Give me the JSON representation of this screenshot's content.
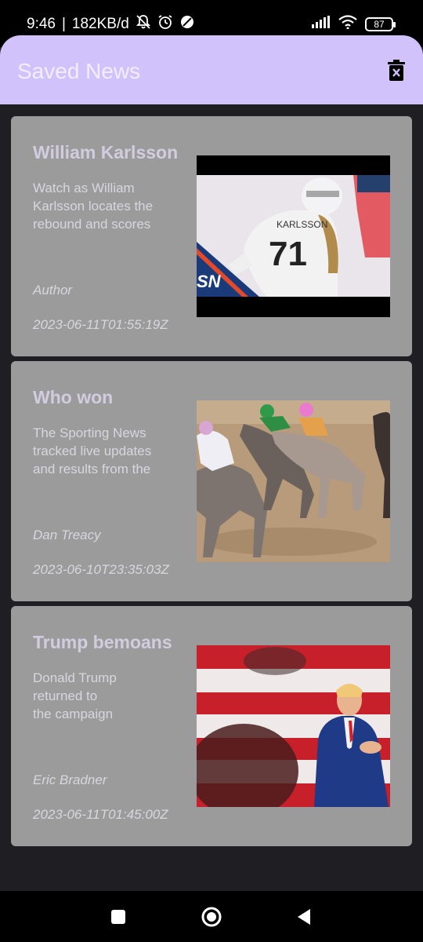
{
  "status_bar": {
    "time": "9:46",
    "network_speed": "182KB/d",
    "battery_level": "87",
    "icons": [
      "bell-off-icon",
      "alarm-icon",
      "data-saver-icon",
      "signal-icon",
      "wifi-icon",
      "battery-icon"
    ]
  },
  "app_bar": {
    "title": "Saved News",
    "action_icon": "delete-icon"
  },
  "articles": [
    {
      "title": "William Karlsson",
      "description": "Watch as William\nKarlsson locates the\nrebound and scores",
      "author": "Author",
      "published_at": "2023-06-11T01:55:19Z",
      "image_alt": "hockey player number 71 in white jersey"
    },
    {
      "title": "Who won",
      "description": "The Sporting News\ntracked live updates\nand results from the",
      "author": "Dan Treacy",
      "published_at": "2023-06-10T23:35:03Z",
      "image_alt": "horse race on dirt track"
    },
    {
      "title": "Trump bemoans",
      "description": "Donald Trump\nreturned to\nthe campaign",
      "author": "Eric Bradner",
      "published_at": "2023-06-11T01:45:00Z",
      "image_alt": "man in blue suit clapping in front of striped flag"
    }
  ],
  "nav_bar": {
    "icons": [
      "recents-icon",
      "home-icon",
      "back-icon"
    ]
  },
  "colors": {
    "app_bar": "#d1c2fb",
    "background": "#1f1e23",
    "card": "#9b9b9b"
  }
}
